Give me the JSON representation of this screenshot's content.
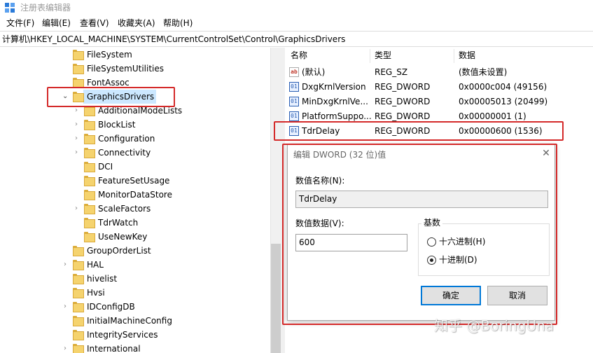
{
  "window": {
    "title": "注册表编辑器"
  },
  "menu": [
    "文件(F)",
    "编辑(E)",
    "查看(V)",
    "收藏夹(A)",
    "帮助(H)"
  ],
  "address": "计算机\\HKEY_LOCAL_MACHINE\\SYSTEM\\CurrentControlSet\\Control\\GraphicsDrivers",
  "tree": {
    "items": [
      {
        "label": "FileSystem"
      },
      {
        "label": "FileSystemUtilities"
      },
      {
        "label": "FontAssoc"
      },
      {
        "label": "GraphicsDrivers",
        "expanded": true,
        "selected": true
      },
      {
        "label": "AdditionalModeLists"
      },
      {
        "label": "BlockList"
      },
      {
        "label": "Configuration"
      },
      {
        "label": "Connectivity"
      },
      {
        "label": "DCI"
      },
      {
        "label": "FeatureSetUsage"
      },
      {
        "label": "MonitorDataStore"
      },
      {
        "label": "ScaleFactors"
      },
      {
        "label": "TdrWatch"
      },
      {
        "label": "UseNewKey"
      },
      {
        "label": "GroupOrderList"
      },
      {
        "label": "HAL"
      },
      {
        "label": "hivelist"
      },
      {
        "label": "Hvsi"
      },
      {
        "label": "IDConfigDB"
      },
      {
        "label": "InitialMachineConfig"
      },
      {
        "label": "IntegrityServices"
      },
      {
        "label": "International"
      }
    ]
  },
  "list": {
    "columns": [
      "名称",
      "类型",
      "数据"
    ],
    "rows": [
      {
        "icon": "string-value-icon",
        "name": "(默认)",
        "type": "REG_SZ",
        "data": "(数值未设置)"
      },
      {
        "icon": "dword-value-icon",
        "name": "DxgKrnlVersion",
        "type": "REG_DWORD",
        "data": "0x0000c004 (49156)"
      },
      {
        "icon": "dword-value-icon",
        "name": "MinDxgKrnlVe...",
        "type": "REG_DWORD",
        "data": "0x00005013 (20499)"
      },
      {
        "icon": "dword-value-icon",
        "name": "PlatformSuppo...",
        "type": "REG_DWORD",
        "data": "0x00000001 (1)"
      },
      {
        "icon": "dword-value-icon",
        "name": "TdrDelay",
        "type": "REG_DWORD",
        "data": "0x00000600 (1536)"
      }
    ]
  },
  "dialog": {
    "title": "编辑 DWORD (32 位)值",
    "close_glyph": "✕",
    "name_label": "数值名称(N):",
    "name_value": "TdrDelay",
    "data_label": "数值数据(V):",
    "data_value": "600",
    "base_label": "基数",
    "radio_hex": "十六进制(H)",
    "radio_dec": "十进制(D)",
    "selected_base": "decimal",
    "ok_label": "确定",
    "cancel_label": "取消"
  },
  "watermark": "知乎 @BoringUna",
  "colors": {
    "highlight": "#d42a2a",
    "selection": "#cce8ff",
    "accent": "#0078d7"
  }
}
